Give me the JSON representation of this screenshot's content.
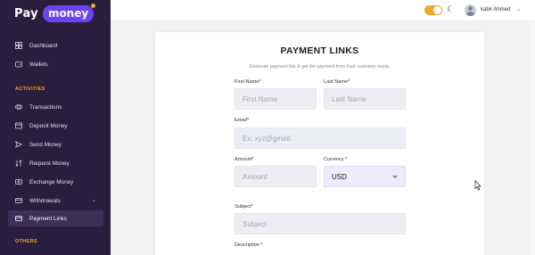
{
  "brand": {
    "part1": "Pay",
    "part2": "money"
  },
  "sidebar": {
    "items": [
      {
        "label": "Dashboard",
        "icon": "dashboard-icon"
      },
      {
        "label": "Wallets",
        "icon": "wallet-icon"
      }
    ],
    "section_activities": "ACTIVITIES",
    "activities": [
      {
        "label": "Transactions",
        "icon": "transactions-icon"
      },
      {
        "label": "Deposit Money",
        "icon": "deposit-icon"
      },
      {
        "label": "Send Money",
        "icon": "send-icon"
      },
      {
        "label": "Request Money",
        "icon": "request-icon"
      },
      {
        "label": "Exchange Money",
        "icon": "exchange-icon"
      },
      {
        "label": "Withdrawals",
        "icon": "withdraw-icon"
      },
      {
        "label": "Payment Links",
        "icon": "payment-link-icon"
      }
    ],
    "section_others": "OTHERS",
    "active": "Payment Links"
  },
  "topbar": {
    "username": "kabir Ahmed",
    "theme_toggle": "on"
  },
  "form": {
    "title": "PAYMENT LINKS",
    "subtitle": "Generate payment link & get the payment from their customer easily.",
    "first_name_label": "First Name",
    "first_name_placeholder": "First Name",
    "last_name_label": "Last Name",
    "last_name_placeholder": "Last Name",
    "email_label": "Email",
    "email_placeholder": "Ex: xyz@gmail.",
    "amount_label": "Amount",
    "amount_placeholder": "Amount",
    "currency_label": "Currency ",
    "currency_value": "USD",
    "subject_label": "Subject",
    "subject_placeholder": "Subject",
    "description_label": "Description ",
    "required_mark": "*"
  },
  "colors": {
    "sidebar_bg": "#2a1e3f",
    "accent": "#6c43f0",
    "section_label": "#f3a52c",
    "toggle": "#f3a52c"
  }
}
